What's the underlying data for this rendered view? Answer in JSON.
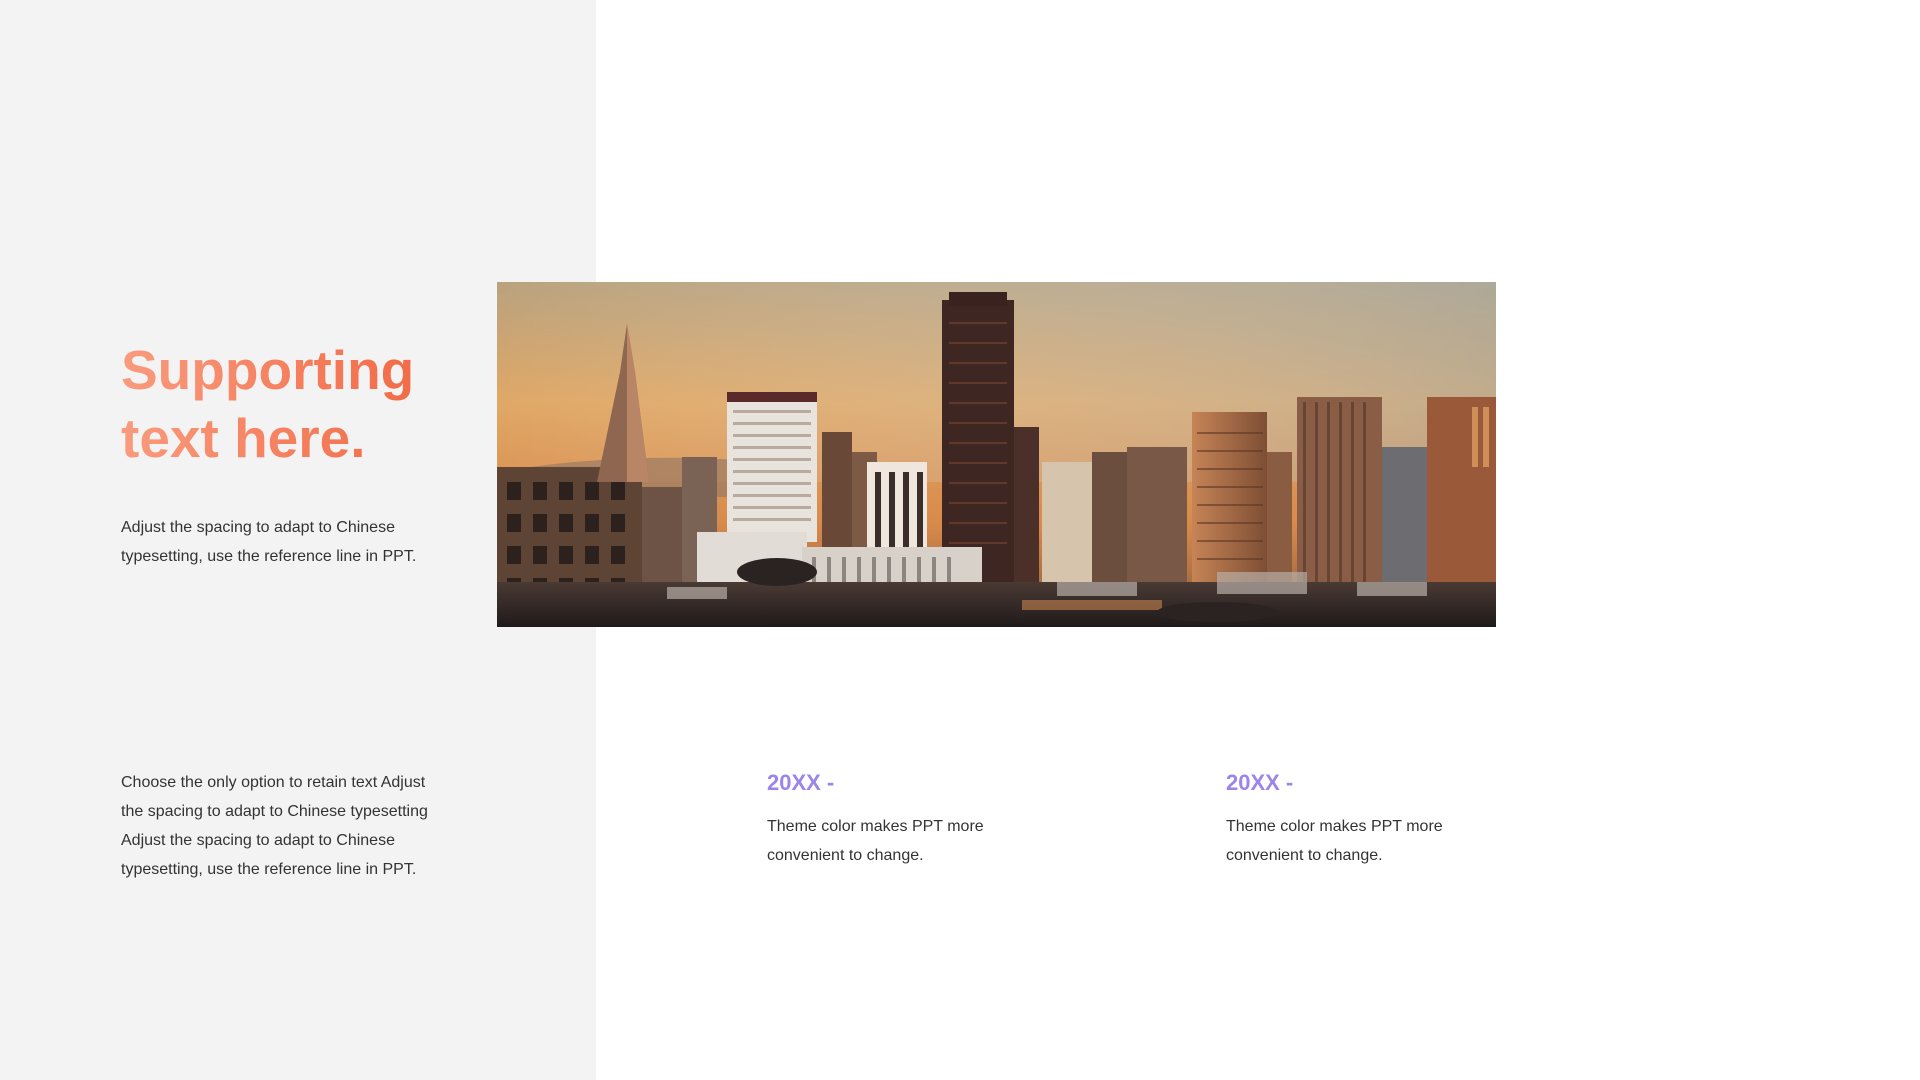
{
  "heading": {
    "line1": "Supporting",
    "line2": "text here."
  },
  "intro": {
    "line1": "Adjust the spacing to adapt to Chinese",
    "line2": "typesetting, use the reference line in PPT."
  },
  "lower_left": {
    "line1": "Choose the only option to retain text Adjust",
    "line2": "the spacing to adapt to Chinese typesetting",
    "line3": "Adjust the spacing to adapt to Chinese",
    "line4": "typesetting, use the reference line in PPT."
  },
  "timeline": [
    {
      "year": "20XX -",
      "line1": "Theme color makes PPT more",
      "line2": "convenient to change."
    },
    {
      "year": "20XX -",
      "line1": "Theme color makes PPT more",
      "line2": "convenient to change."
    }
  ],
  "colors": {
    "accent_orange": "#f2724e",
    "accent_purple": "#9b84ea",
    "panel_gray": "#f3f3f3"
  }
}
